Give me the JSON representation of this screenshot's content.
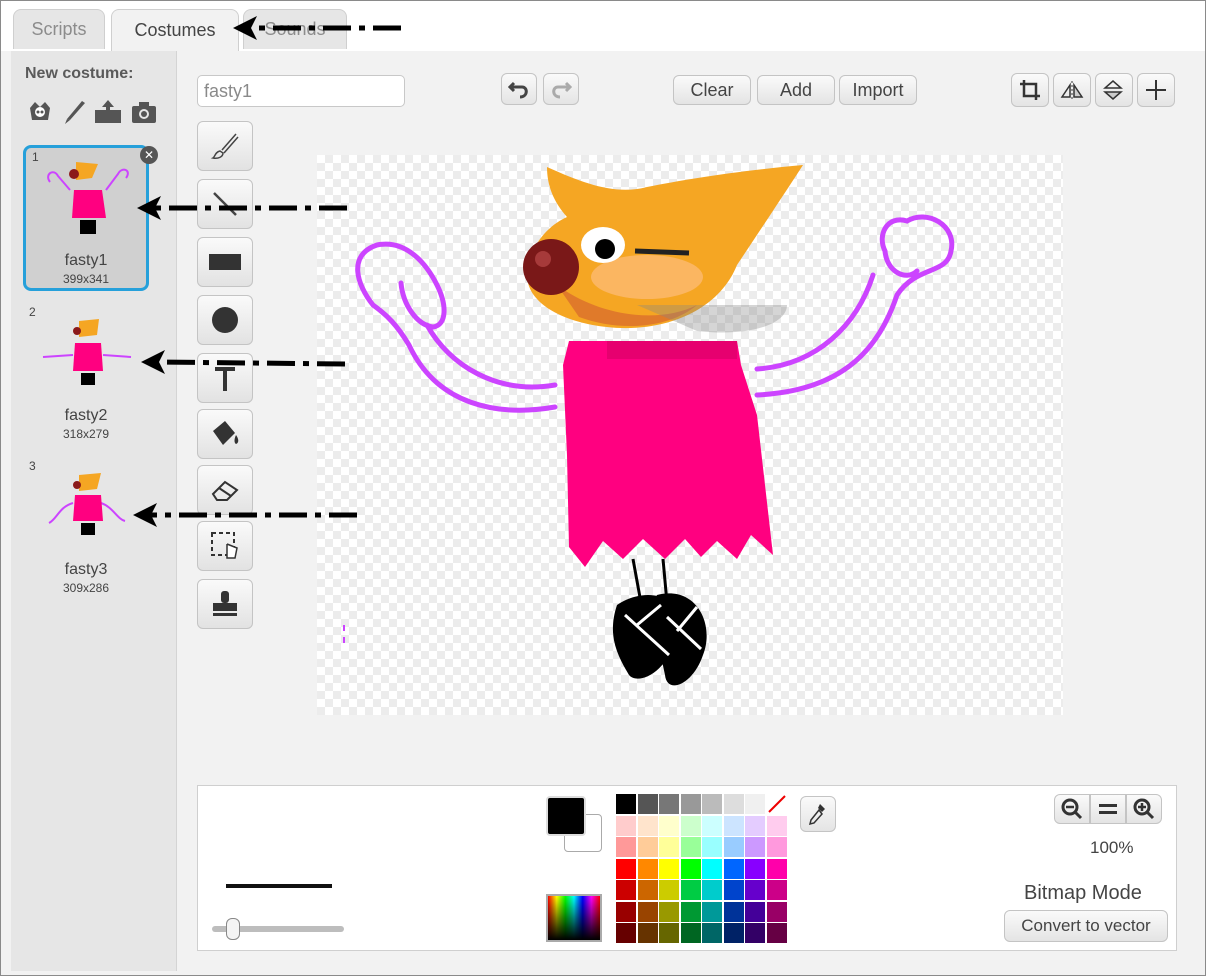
{
  "tabs": [
    {
      "label": "Scripts"
    },
    {
      "label": "Costumes"
    },
    {
      "label": "Sounds"
    }
  ],
  "left_panel": {
    "title": "New costume:",
    "new_costume_icons": [
      "paint-from-library-icon",
      "paint-brush-icon",
      "upload-icon",
      "camera-icon"
    ],
    "costumes": [
      {
        "number": "1",
        "name": "fasty1",
        "size": "399x341",
        "selected": true
      },
      {
        "number": "2",
        "name": "fasty2",
        "size": "318x279",
        "selected": false
      },
      {
        "number": "3",
        "name": "fasty3",
        "size": "309x286",
        "selected": false
      }
    ]
  },
  "editor": {
    "costume_name": "fasty1",
    "buttons": {
      "clear": "Clear",
      "add": "Add",
      "import": "Import"
    },
    "tools": [
      "brush-icon",
      "line-icon",
      "rectangle-icon",
      "ellipse-icon",
      "text-icon",
      "fill-icon",
      "eraser-icon",
      "select-icon",
      "stamp-icon"
    ],
    "top_right_tools": [
      "crop-icon",
      "flip-horizontal-icon",
      "flip-vertical-icon",
      "set-center-icon"
    ]
  },
  "bottom": {
    "zoom_percent": "100%",
    "mode": "Bitmap Mode",
    "convert_button": "Convert to vector",
    "primary_color": "#000000",
    "secondary_color": "#ffffff",
    "palette": [
      [
        "#000000",
        "#555555",
        "#777777",
        "#999999",
        "#bbbbbb",
        "#dddddd",
        "#f0f0f0",
        "none"
      ],
      [
        "#ffcccc",
        "#ffe4cc",
        "#ffffcc",
        "#ccffcc",
        "#ccffff",
        "#cce4ff",
        "#e4ccff",
        "#ffccee"
      ],
      [
        "#ff9999",
        "#ffcc99",
        "#ffff99",
        "#99ff99",
        "#99ffff",
        "#99ccff",
        "#cc99ff",
        "#ff99dd"
      ],
      [
        "#ff0000",
        "#ff8800",
        "#ffff00",
        "#00ff00",
        "#00ffff",
        "#0066ff",
        "#8800ff",
        "#ff00aa"
      ],
      [
        "#cc0000",
        "#cc6600",
        "#cccc00",
        "#00cc44",
        "#00cccc",
        "#0044cc",
        "#6600cc",
        "#cc0088"
      ],
      [
        "#990000",
        "#994400",
        "#999900",
        "#009933",
        "#009999",
        "#003399",
        "#440099",
        "#990066"
      ],
      [
        "#660000",
        "#663300",
        "#666600",
        "#006622",
        "#006666",
        "#002266",
        "#330066",
        "#660044"
      ]
    ]
  }
}
